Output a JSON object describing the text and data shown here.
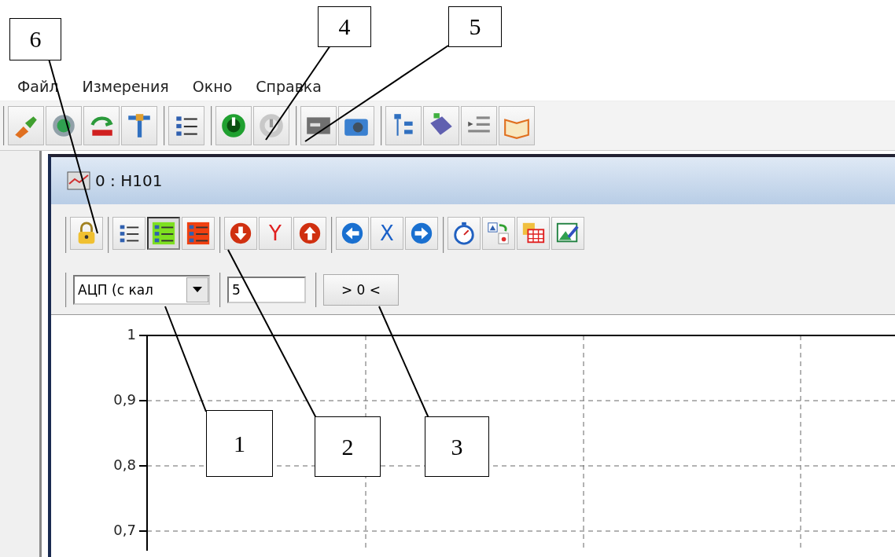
{
  "callouts": [
    {
      "label": "6"
    },
    {
      "label": "4"
    },
    {
      "label": "5"
    },
    {
      "label": "1"
    },
    {
      "label": "2"
    },
    {
      "label": "3"
    }
  ],
  "menu": [
    {
      "label": "Файл"
    },
    {
      "label": "Измерения"
    },
    {
      "label": "Окно"
    },
    {
      "label": "Справка"
    }
  ],
  "window": {
    "title": "0 : H101"
  },
  "window_toolbar": {
    "list_green_pressed": true,
    "y_label": "Y",
    "x_label": "X"
  },
  "channel_select": {
    "value": "АЦП (с кал"
  },
  "value_field": {
    "value": "5"
  },
  "zero_button": {
    "label": "> 0 <"
  },
  "plot": {
    "y_axis_labels": [
      {
        "label": "1"
      },
      {
        "label": "0,9"
      },
      {
        "label": "0,8"
      },
      {
        "label": "0,7"
      }
    ]
  }
}
